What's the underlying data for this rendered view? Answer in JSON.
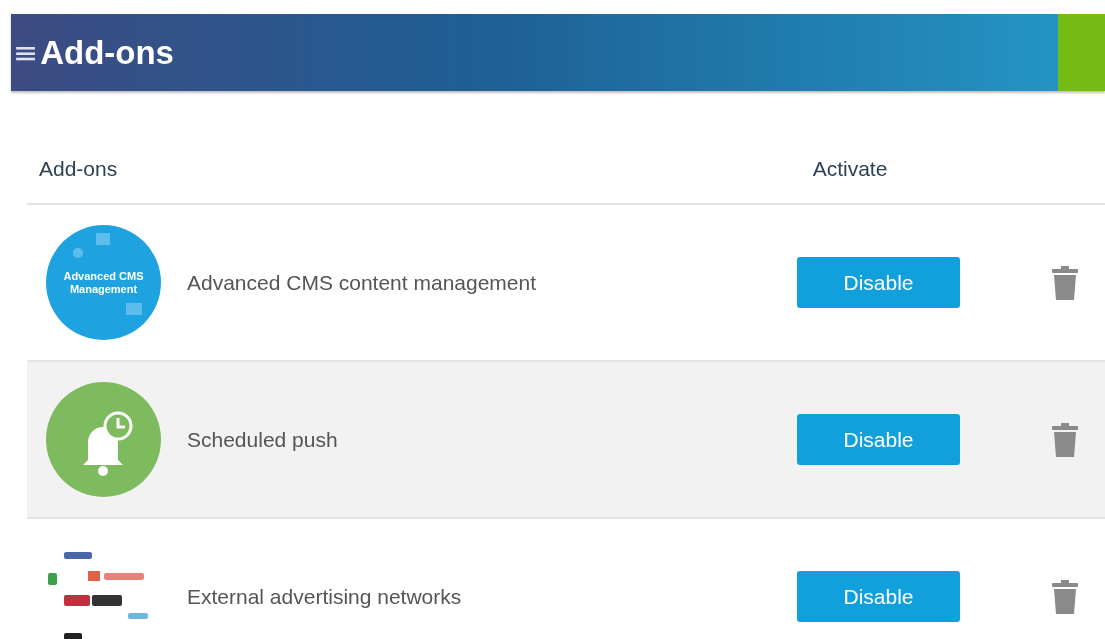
{
  "header": {
    "menu_icon": "≡",
    "title": "Add-ons"
  },
  "table": {
    "columns": [
      "Add-ons",
      "Activate"
    ],
    "rows": [
      {
        "kind": "badge",
        "icon_text": "Advanced CMS Management",
        "color": "#1ea3e0",
        "name": "Advanced CMS content management",
        "action": "Disable",
        "highlighted": false
      },
      {
        "kind": "bell",
        "color": "#7dbb5e",
        "name": "Scheduled push",
        "action": "Disable",
        "highlighted": true
      },
      {
        "kind": "picture",
        "name": "External advertising networks",
        "action": "Disable",
        "highlighted": false
      }
    ]
  }
}
